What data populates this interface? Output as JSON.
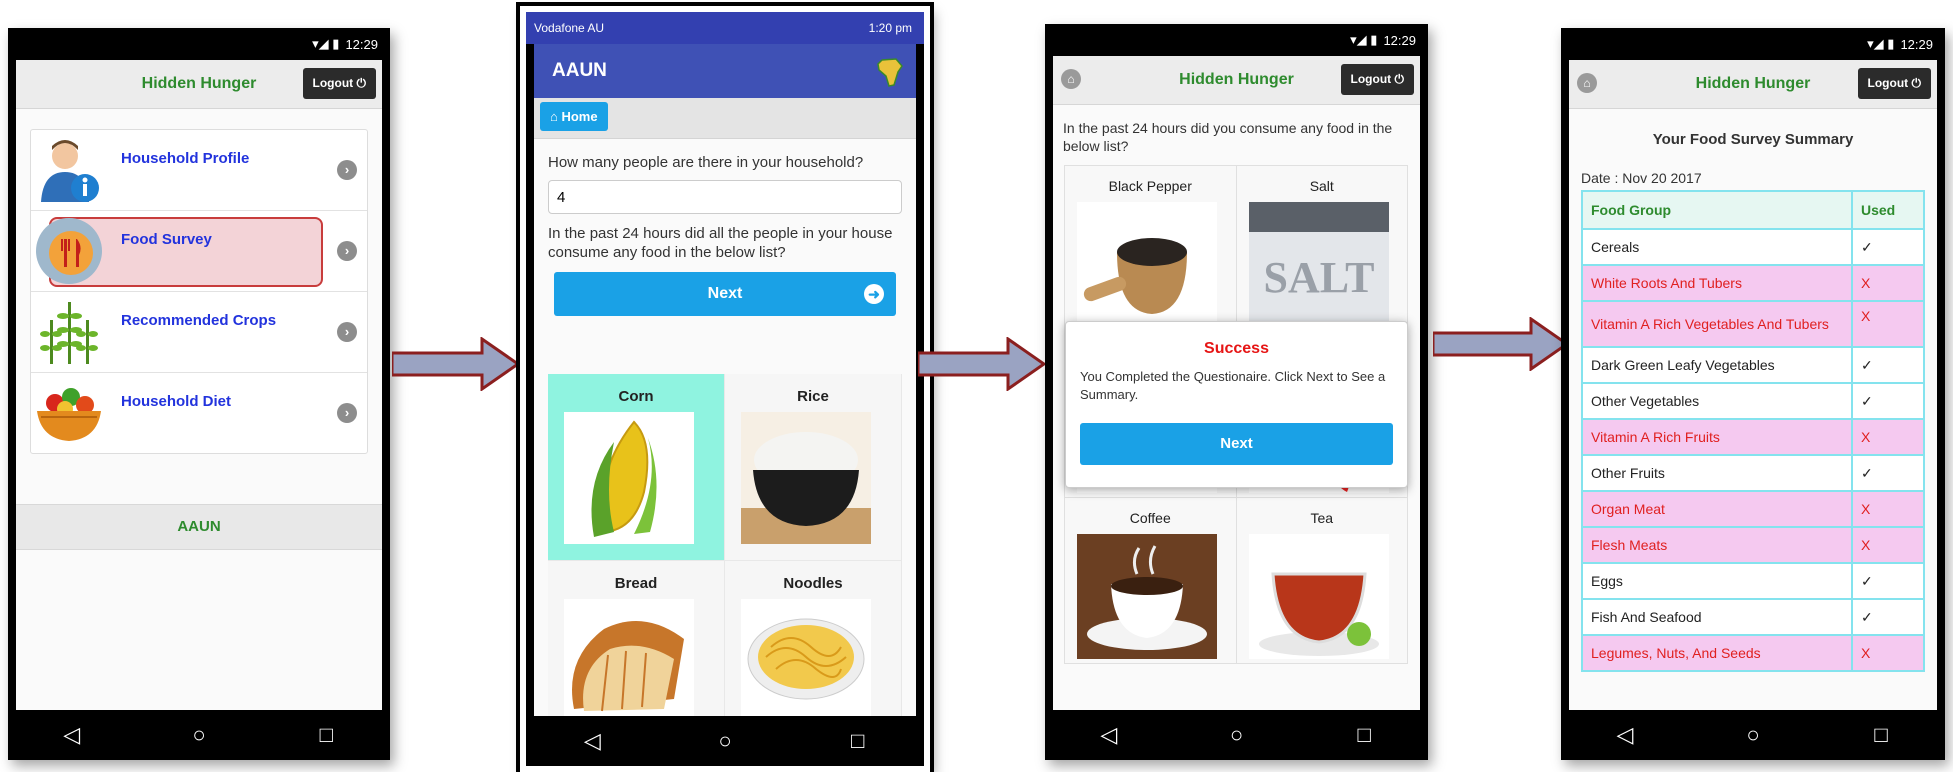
{
  "screen1": {
    "time": "12:29",
    "title": "Hidden Hunger",
    "logout": "Logout ⏻",
    "items": [
      {
        "label": "Household Profile"
      },
      {
        "label": "Food Survey"
      },
      {
        "label": "Recommended Crops"
      },
      {
        "label": "Household Diet"
      }
    ],
    "footer": "AAUN"
  },
  "screen2": {
    "carrier": "Vodafone AU",
    "time": "1:20 pm",
    "app_title": "AAUN",
    "home": "Home",
    "question1": "How many people are there in your household?",
    "answer1": "4",
    "question2": "In the past 24 hours did all the people in your house consume any food in the below list?",
    "next": "Next",
    "foods": [
      "Corn",
      "Rice",
      "Bread",
      "Noodles"
    ]
  },
  "screen3": {
    "time": "12:29",
    "title": "Hidden Hunger",
    "logout": "Logout ⏻",
    "question": "In the past 24 hours did you consume any food in the below list?",
    "foods": [
      "Black Pepper",
      "Salt",
      "Coffee",
      "Tea"
    ],
    "modal": {
      "title": "Success",
      "text": "You Completed the Questionaire. Click Next to See a Summary.",
      "button": "Next"
    }
  },
  "screen4": {
    "time": "12:29",
    "title": "Hidden Hunger",
    "logout": "Logout ⏻",
    "summary_title": "Your Food Survey Summary",
    "date": "Date : Nov 20 2017",
    "headers": [
      "Food Group",
      "Used"
    ],
    "rows": [
      {
        "group": "Cereals",
        "used": "✓"
      },
      {
        "group": "White Roots And Tubers",
        "used": "X"
      },
      {
        "group": "Vitamin A Rich Vegetables And Tubers",
        "used": "X"
      },
      {
        "group": "Dark Green Leafy Vegetables",
        "used": "✓"
      },
      {
        "group": "Other Vegetables",
        "used": "✓"
      },
      {
        "group": "Vitamin A Rich Fruits",
        "used": "X"
      },
      {
        "group": "Other Fruits",
        "used": "✓"
      },
      {
        "group": "Organ Meat",
        "used": "X"
      },
      {
        "group": "Flesh Meats",
        "used": "X"
      },
      {
        "group": "Eggs",
        "used": "✓"
      },
      {
        "group": "Fish And Seafood",
        "used": "✓"
      },
      {
        "group": "Legumes, Nuts, And Seeds",
        "used": "X"
      }
    ]
  },
  "nav_icons": [
    "back-icon",
    "home-circle-icon",
    "recents-icon"
  ],
  "colors": {
    "accent_blue": "#1aa1e6",
    "title_green": "#2e8b2e",
    "indigo": "#3f51b5",
    "arrow_red": "#8b1f1f",
    "no_pink": "#f5c9f0",
    "no_red": "#e02020"
  }
}
